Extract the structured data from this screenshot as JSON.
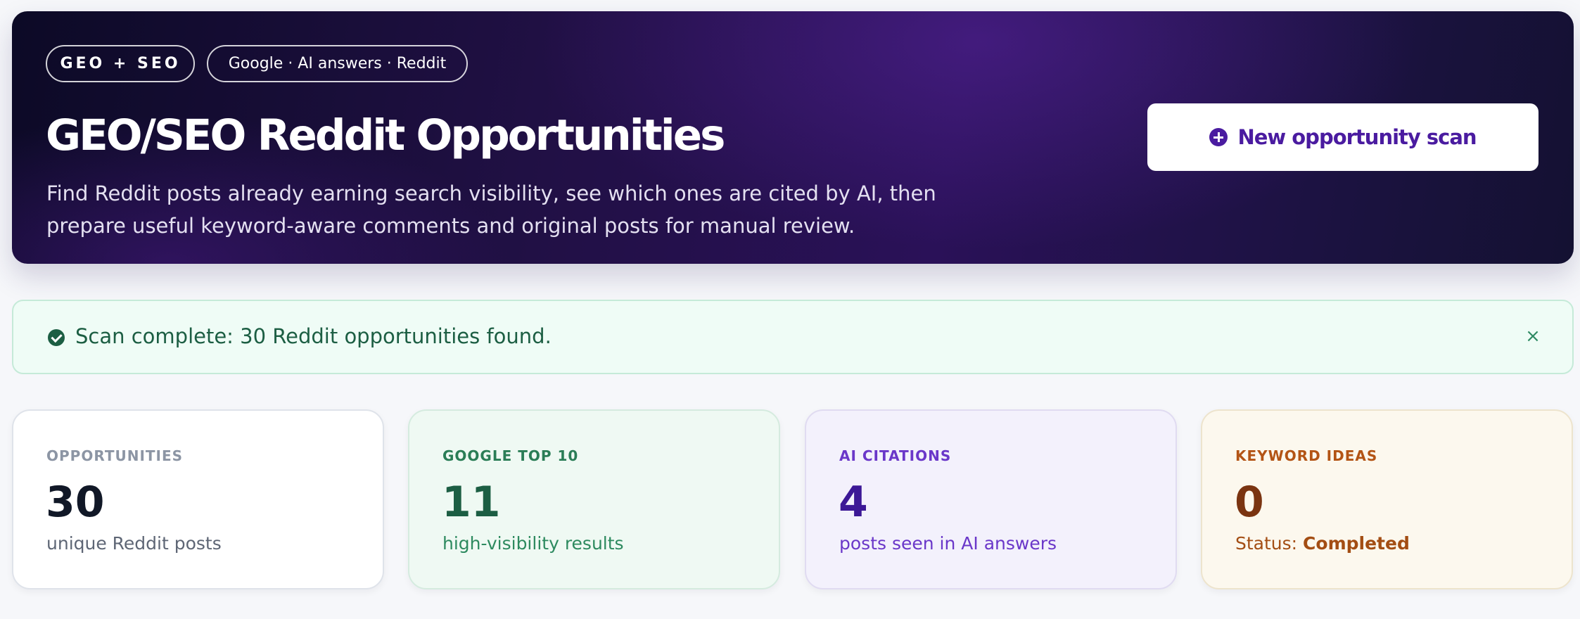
{
  "hero": {
    "badge_primary": "GEO + SEO",
    "badge_sources": "Google · AI answers · Reddit",
    "title": "GEO/SEO Reddit Opportunities",
    "description": "Find Reddit posts already earning search visibility, see which ones are cited by AI, then prepare useful keyword-aware comments and original posts for manual review.",
    "cta_label": "New opportunity scan",
    "cta_icon": "plus-circle-icon",
    "accent_color": "#4a1ba0"
  },
  "alert": {
    "message": "Scan complete: 30 Reddit opportunities found.",
    "icon": "check-circle-icon",
    "dismiss_label": "×",
    "color": "#1c5e43"
  },
  "stats": [
    {
      "label": "OPPORTUNITIES",
      "value": "30",
      "sub": "unique Reddit posts",
      "color": "#111827"
    },
    {
      "label": "GOOGLE TOP 10",
      "value": "11",
      "sub": "high-visibility results",
      "color": "#1c5e43"
    },
    {
      "label": "AI CITATIONS",
      "value": "4",
      "sub": "posts seen in AI answers",
      "color": "#3c1896"
    },
    {
      "label": "KEYWORD IDEAS",
      "value": "0",
      "sub_prefix": "Status: ",
      "sub_status": "Completed",
      "color": "#7a3411"
    }
  ]
}
